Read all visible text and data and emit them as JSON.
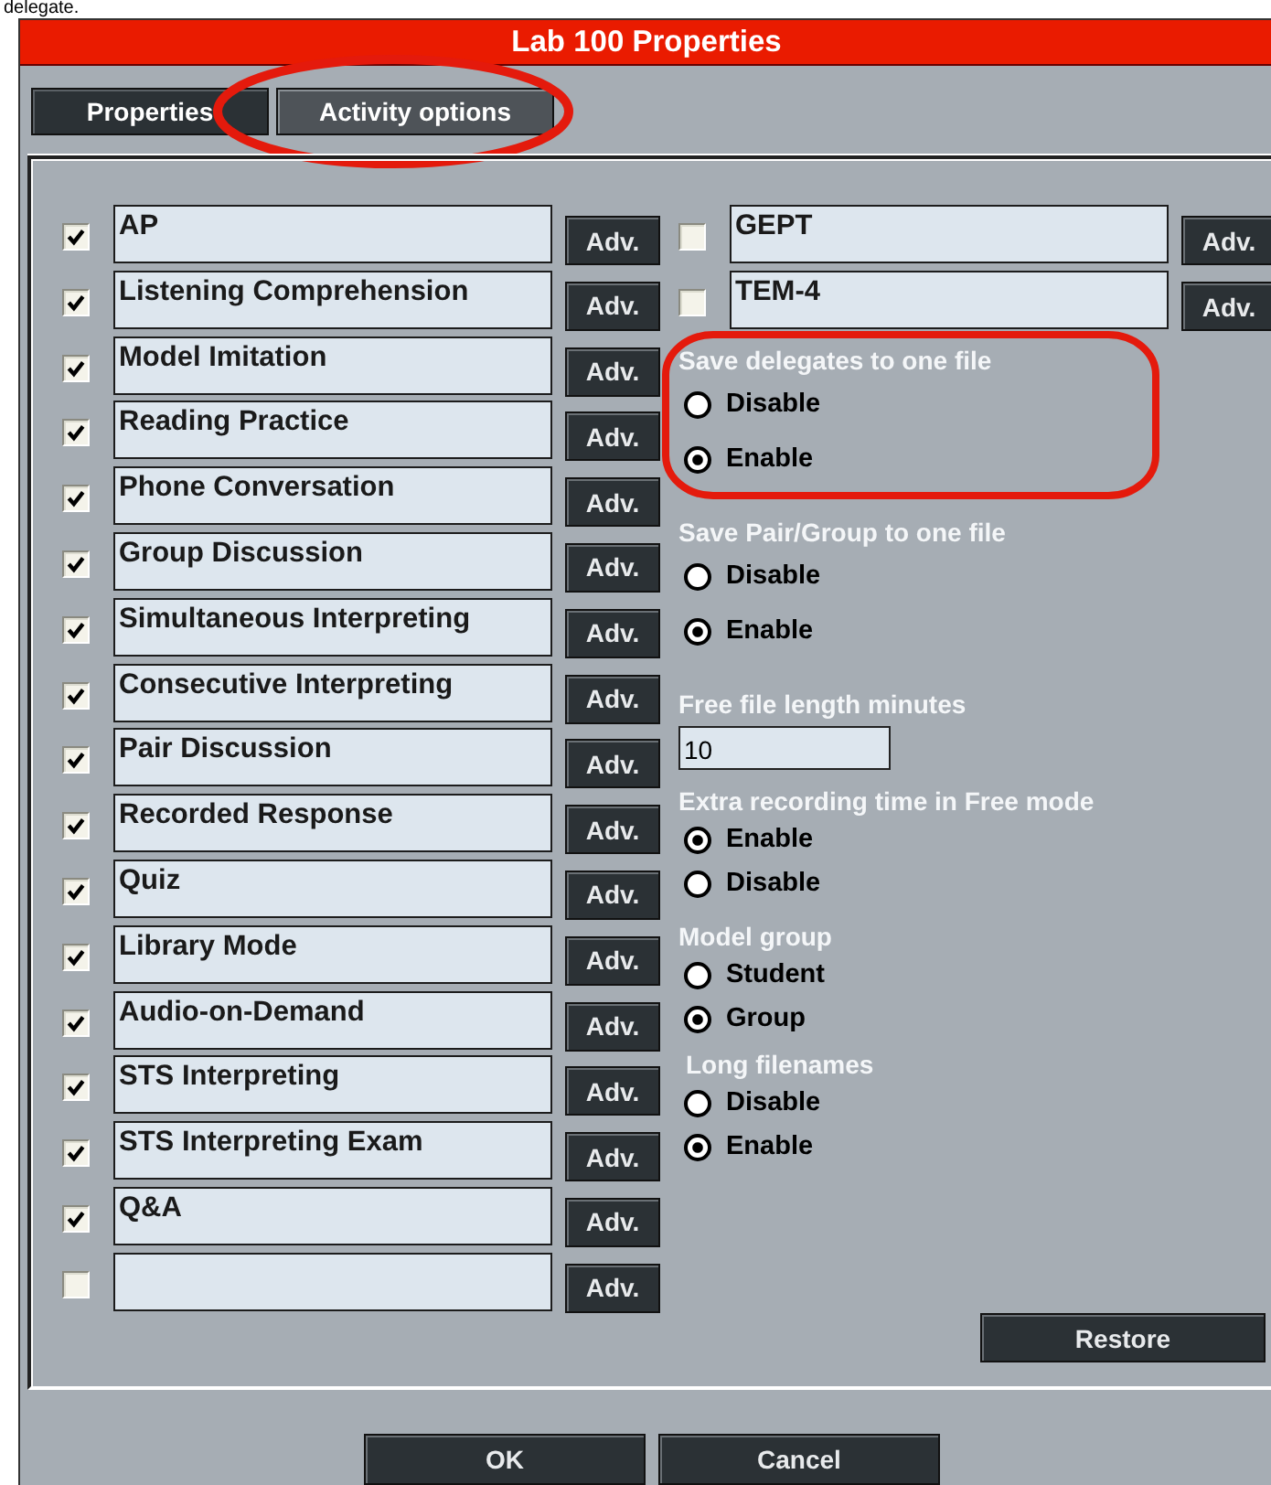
{
  "caption": "delegate.",
  "window": {
    "title": "Lab 100 Properties"
  },
  "tabs": [
    {
      "label": "Properties",
      "selected": false,
      "circled": false
    },
    {
      "label": "Activity options",
      "selected": true,
      "circled": true
    }
  ],
  "activities": [
    {
      "label": "AP",
      "checked": true,
      "button": "Adv."
    },
    {
      "label": "Listening Comprehension",
      "checked": true,
      "button": "Adv."
    },
    {
      "label": "Model Imitation",
      "checked": true,
      "button": "Adv."
    },
    {
      "label": "Reading Practice",
      "checked": true,
      "button": "Adv."
    },
    {
      "label": "Phone Conversation",
      "checked": true,
      "button": "Adv."
    },
    {
      "label": "Group Discussion",
      "checked": true,
      "button": "Adv."
    },
    {
      "label": "Simultaneous Interpreting",
      "checked": true,
      "button": "Adv."
    },
    {
      "label": "Consecutive Interpreting",
      "checked": true,
      "button": "Adv."
    },
    {
      "label": "Pair Discussion",
      "checked": true,
      "button": "Adv."
    },
    {
      "label": "Recorded Response",
      "checked": true,
      "button": "Adv."
    },
    {
      "label": "Quiz",
      "checked": true,
      "button": "Adv."
    },
    {
      "label": "Library Mode",
      "checked": true,
      "button": "Adv."
    },
    {
      "label": "Audio-on-Demand",
      "checked": true,
      "button": "Adv."
    },
    {
      "label": "STS Interpreting",
      "checked": true,
      "button": "Adv."
    },
    {
      "label": "STS Interpreting Exam",
      "checked": true,
      "button": "Adv."
    },
    {
      "label": "Q&A",
      "checked": true,
      "button": "Adv."
    },
    {
      "checked": false,
      "button": "Adv."
    }
  ],
  "extra_activities": [
    {
      "label": "GEPT",
      "checked": false,
      "button": "Adv."
    },
    {
      "label": "TEM-4",
      "checked": false,
      "button": "Adv."
    }
  ],
  "options": [
    {
      "kind": "radio",
      "title": "Save delegates to one file",
      "circled": true,
      "choices": [
        {
          "label": "Disable",
          "selected": false
        },
        {
          "label": "Enable",
          "selected": true
        }
      ]
    },
    {
      "kind": "radio",
      "title": "Save Pair/Group to one file",
      "circled": false,
      "choices": [
        {
          "label": "Disable",
          "selected": false
        },
        {
          "label": "Enable",
          "selected": true
        }
      ]
    },
    {
      "kind": "number",
      "title": "Free file length minutes",
      "value": "10"
    },
    {
      "kind": "radio",
      "title": "Extra recording time in Free mode",
      "circled": false,
      "choices": [
        {
          "label": "Enable",
          "selected": true
        },
        {
          "label": "Disable",
          "selected": false
        }
      ]
    },
    {
      "kind": "radio",
      "title": "Model group",
      "circled": false,
      "choices": [
        {
          "label": "Student",
          "selected": false
        },
        {
          "label": "Group",
          "selected": true
        }
      ]
    },
    {
      "kind": "radio",
      "title": "Long filenames",
      "circled": false,
      "choices": [
        {
          "label": "Disable",
          "selected": false
        },
        {
          "label": "Enable",
          "selected": true
        }
      ]
    }
  ],
  "restore_button": "Restore",
  "buttons": [
    "OK",
    "Cancel"
  ]
}
